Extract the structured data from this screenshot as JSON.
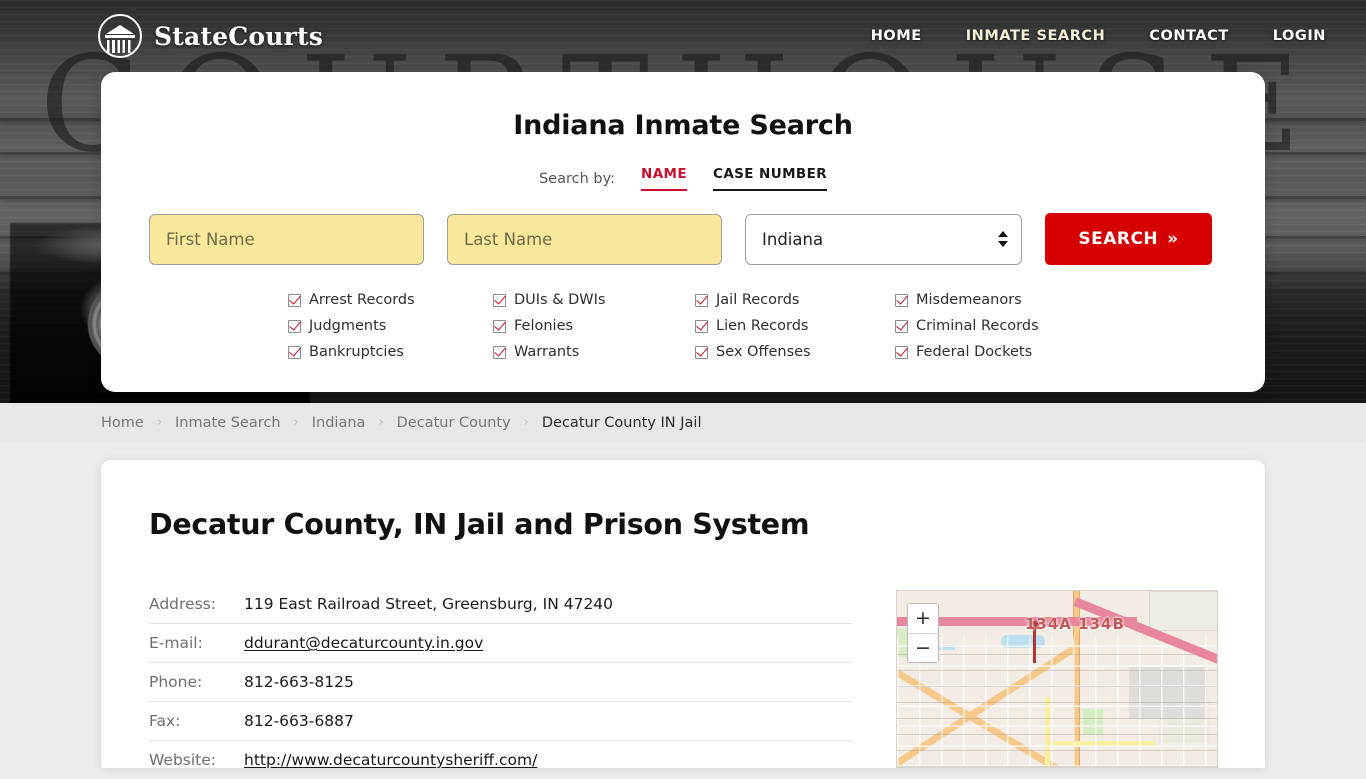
{
  "header": {
    "brand_name": "StateCourts",
    "logo_icon": "courthouse-icon",
    "nav": [
      {
        "label": "HOME",
        "active": false
      },
      {
        "label": "INMATE SEARCH",
        "active": true
      },
      {
        "label": "CONTACT",
        "active": false
      },
      {
        "label": "LOGIN",
        "active": false
      }
    ],
    "background_word": "COURTHOUSE"
  },
  "search_panel": {
    "title": "Indiana Inmate Search",
    "search_by_label": "Search by:",
    "tabs": [
      {
        "label": "NAME",
        "active": true,
        "color": "#c8102e"
      },
      {
        "label": "CASE NUMBER",
        "active": false,
        "color": "#1a1a1a"
      }
    ],
    "first_name": {
      "value": "",
      "placeholder": "First Name"
    },
    "last_name": {
      "value": "",
      "placeholder": "Last Name"
    },
    "state_select": {
      "value": "Indiana",
      "icon": "chevron-updown-icon"
    },
    "submit": {
      "label": "SEARCH",
      "icon": "double-chevron-right-icon",
      "color": "#d70000"
    },
    "record_types": [
      "Arrest Records",
      "DUIs & DWIs",
      "Jail Records",
      "Misdemeanors",
      "Judgments",
      "Felonies",
      "Lien Records",
      "Criminal Records",
      "Bankruptcies",
      "Warrants",
      "Sex Offenses",
      "Federal Dockets"
    ]
  },
  "breadcrumb": {
    "separator": "›",
    "items": [
      {
        "label": "Home",
        "current": false
      },
      {
        "label": "Inmate Search",
        "current": false
      },
      {
        "label": "Indiana",
        "current": false
      },
      {
        "label": "Decatur County",
        "current": false
      },
      {
        "label": "Decatur County IN Jail",
        "current": true
      }
    ]
  },
  "main": {
    "page_title": "Decatur County, IN Jail and Prison System",
    "details": [
      {
        "key": "Address:",
        "value": "119 East Railroad Street, Greensburg, IN 47240",
        "link": false
      },
      {
        "key": "E-mail:",
        "value": "ddurant@decaturcounty.in.gov",
        "link": true
      },
      {
        "key": "Phone:",
        "value": "812-663-8125",
        "link": false
      },
      {
        "key": "Fax:",
        "value": "812-663-6887",
        "link": false
      },
      {
        "key": "Website:",
        "value": "http://www.decaturcountysheriff.com/",
        "link": true
      }
    ]
  },
  "map": {
    "zoom_in_label": "+",
    "zoom_out_label": "−",
    "road_label": "134A 134B"
  }
}
